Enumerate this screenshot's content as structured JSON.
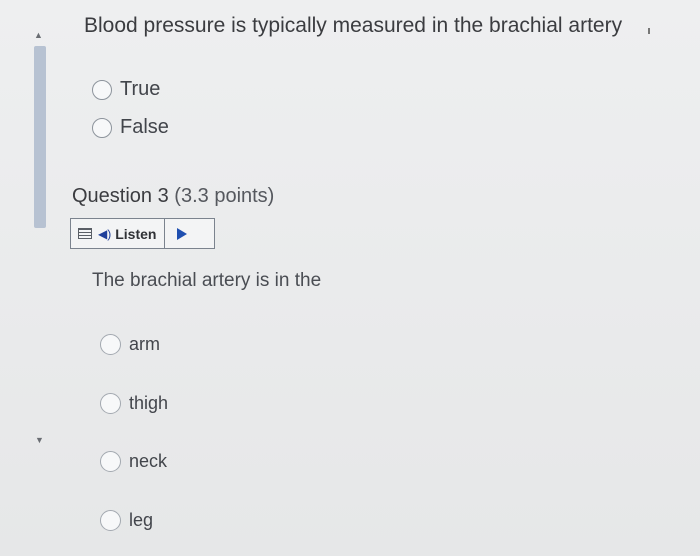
{
  "previous_question": {
    "text": "Blood pressure is typically measured in the brachial artery",
    "options": [
      {
        "label": "True"
      },
      {
        "label": "False"
      }
    ]
  },
  "question": {
    "title": "Question 3",
    "points": "(3.3 points)",
    "listen_label": "Listen",
    "text": "The brachial artery is in the",
    "options": [
      {
        "label": "arm"
      },
      {
        "label": "thigh"
      },
      {
        "label": "neck"
      },
      {
        "label": "leg"
      }
    ]
  },
  "icons": {
    "scroll_up": "chevron-up-icon",
    "scroll_down": "chevron-down-icon",
    "menu": "menu-icon",
    "speaker": "speaker-icon",
    "play": "play-icon"
  },
  "colors": {
    "background": "#e9eaeb",
    "scroll_thumb": "#b7c2d2",
    "accent_blue": "#1f4fb0"
  }
}
